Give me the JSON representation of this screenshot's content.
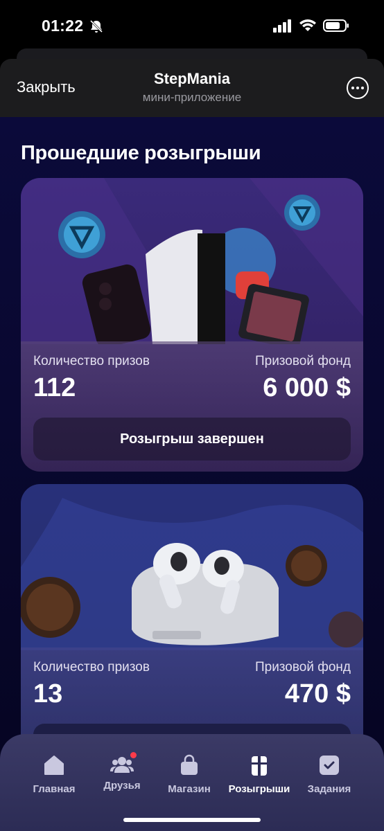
{
  "status_bar": {
    "time": "01:22"
  },
  "header": {
    "close_label": "Закрыть",
    "title": "StepMania",
    "subtitle": "мини-приложение"
  },
  "main": {
    "section_title": "Прошедшие розыгрыши",
    "cards": [
      {
        "prizes_label": "Количество призов",
        "prizes_value": "112",
        "fund_label": "Призовой фонд",
        "fund_value": "6 000 $",
        "status_label": "Розыгрыш завершен"
      },
      {
        "prizes_label": "Количество призов",
        "prizes_value": "13",
        "fund_label": "Призовой фонд",
        "fund_value": "470 $"
      }
    ]
  },
  "nav": {
    "items": [
      {
        "label": "Главная",
        "icon": "home-icon"
      },
      {
        "label": "Друзья",
        "icon": "friends-icon"
      },
      {
        "label": "Магазин",
        "icon": "shop-bag-icon"
      },
      {
        "label": "Розыгрыши",
        "icon": "gift-icon"
      },
      {
        "label": "Задания",
        "icon": "tasks-icon"
      }
    ],
    "active": "Розыгрыши"
  },
  "colors": {
    "background": "#08072b",
    "badge": "#ff3b4a"
  }
}
